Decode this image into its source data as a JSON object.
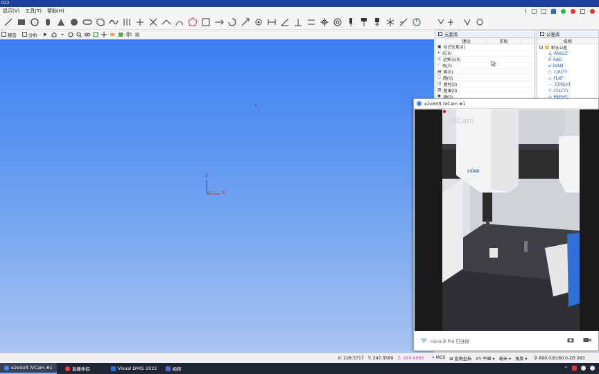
{
  "window": {
    "title": "022"
  },
  "menubar": {
    "items": [
      "显示(V)",
      "工具(T)",
      "帮助(H)"
    ],
    "right_number": "1"
  },
  "toolbar1": {
    "icons": [
      "line-icon",
      "rect-icon",
      "circle-icon",
      "cylinder-icon",
      "cone-icon",
      "sphere-icon",
      "slot-icon",
      "cube-icon",
      "curve-icon",
      "align-icon",
      "cross-icon",
      "intersect-icon",
      "plane-icon",
      "arc-icon",
      "polygon-icon",
      "frame-icon",
      "translate-icon",
      "rotate-icon",
      "scale-icon",
      "settings-icon",
      "distance-icon",
      "angle-icon",
      "perpendicular-icon",
      "parallel-icon",
      "position-icon",
      "target-icon",
      "probe-icon",
      "probe-tool-icon",
      "probe-config-icon",
      "probe-star-icon",
      "probe-angle-icon",
      "probe-rotate-icon"
    ]
  },
  "toolbar2": {
    "items": [
      {
        "icon": "report-icon",
        "label": "报告"
      },
      {
        "icon": "analyze-icon",
        "label": "分析"
      }
    ]
  },
  "element_library": {
    "tab_label": "元素库",
    "col_name": "理论",
    "col_actual": "实际",
    "rows": [
      "标识元系(0)",
      "点(0)",
      "边界点(0)",
      "线(0)",
      "面(0)",
      "圆(0)",
      "圆柱(0)",
      "圆锥(0)",
      "球(0)"
    ]
  },
  "tolerance_panel": {
    "tab_label": "公差库",
    "col_name": "名称",
    "root": "默认公差",
    "items": [
      "ANGLE",
      "RAD",
      "DIAM",
      "CIRLTY",
      "FLAT",
      "STRGHT",
      "CYLCTY",
      "PRFSFC"
    ]
  },
  "viewport": {
    "axis_z": "Z",
    "axis_x": "X"
  },
  "camera_window": {
    "title": "e2eSoft iVCam #1",
    "watermark": "iVCam",
    "machine_brand": "LEAD",
    "status_text": "nova 8 Pro 已连接"
  },
  "statusbar": {
    "x_label": "X:",
    "x_value": "228.5717",
    "y_label": "Y:",
    "y_value": "247.0509",
    "z_label": "Z:",
    "z_value": "414.0693",
    "coord_mode": "MCS",
    "coord_system": "直角坐标",
    "plane": "XY 平面",
    "unit": "毫米",
    "angle_mode": "角度",
    "probe_angle": "A90.0-B180.0-D3.993",
    "colors": {
      "z_value": "#c83cc8"
    }
  },
  "taskbar": {
    "items": [
      {
        "label": "e2eSoft iVCam #1",
        "color": "#3d8bff",
        "active": true
      },
      {
        "label": "直播伴侣",
        "color": "#ff3b3b",
        "active": false
      },
      {
        "label": "Visual DMIS 2022",
        "color": "#2b73d6",
        "active": false
      },
      {
        "label": "视频",
        "color": "#5c6bd0",
        "active": false
      }
    ]
  }
}
